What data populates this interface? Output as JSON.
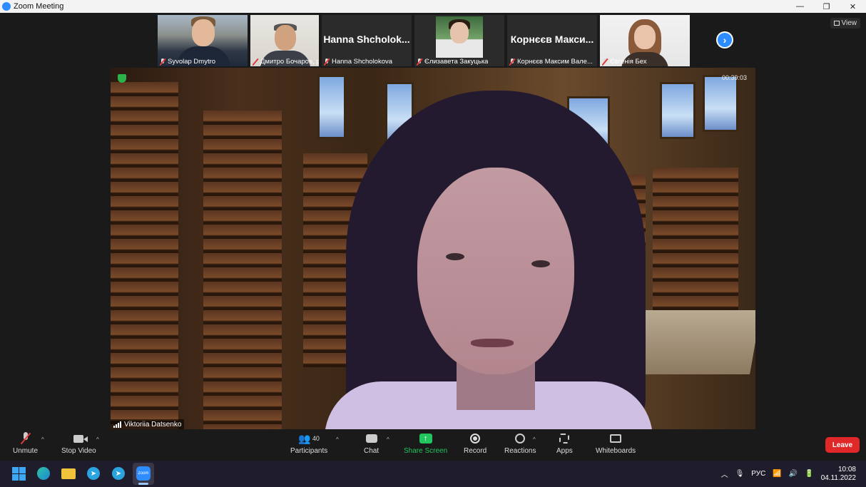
{
  "window": {
    "title": "Zoom Meeting",
    "minimize": "—",
    "maximize": "❐",
    "close": "✕"
  },
  "view_button": {
    "label": "View"
  },
  "thumbnails": [
    {
      "label": "Syvolap Dmytro"
    },
    {
      "label": "Дмитро Бочаров, рек..."
    },
    {
      "display_name": "Hanna Shcholok...",
      "label": "Hanna Shcholokova"
    },
    {
      "label": "Єлизавета Закуцька"
    },
    {
      "display_name": "Корнєєв Макси...",
      "label": "Корнєєв Максим Вале..."
    },
    {
      "label": "Євгенія Бех"
    }
  ],
  "speaker": {
    "name": "Viktoriia Datsenko",
    "timer": "00:39:03"
  },
  "toolbar": {
    "unmute": "Unmute",
    "stop_video": "Stop Video",
    "participants": "Participants",
    "participants_count": "40",
    "chat": "Chat",
    "share_screen": "Share Screen",
    "record": "Record",
    "reactions": "Reactions",
    "apps": "Apps",
    "whiteboards": "Whiteboards",
    "leave": "Leave"
  },
  "taskbar": {
    "language": "РУС",
    "time": "10:08",
    "date": "04.11.2022"
  },
  "colors": {
    "accent": "#2d8cff",
    "leave": "#e02828",
    "share": "#22c55e"
  }
}
